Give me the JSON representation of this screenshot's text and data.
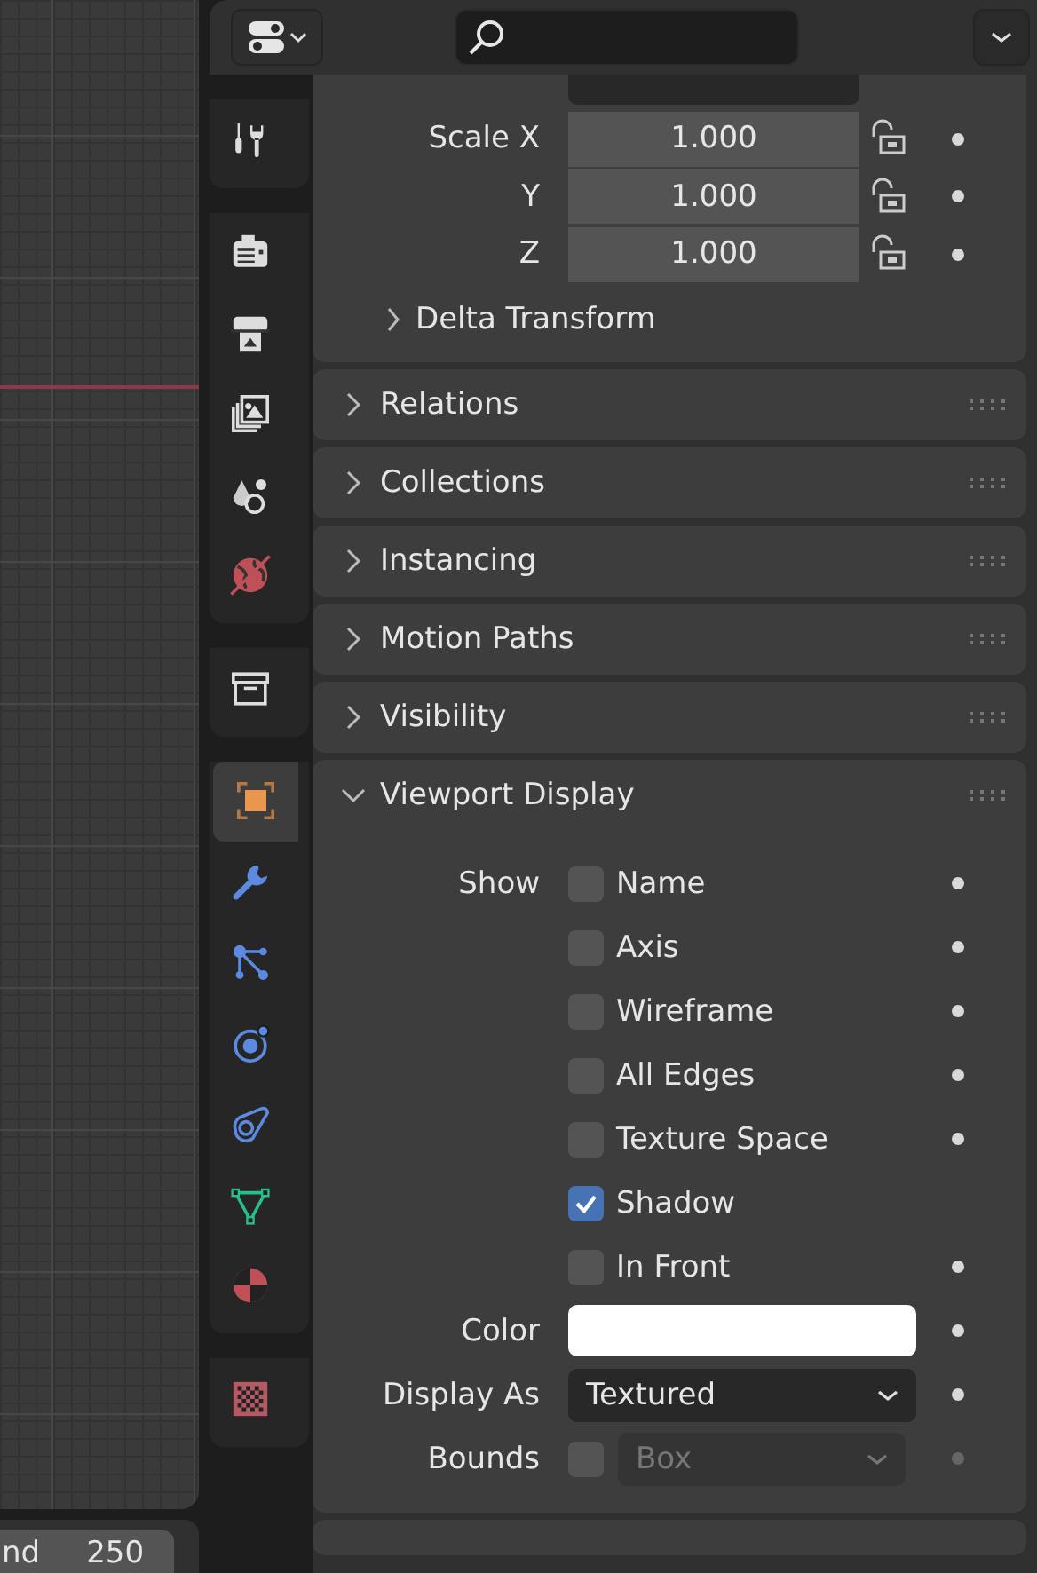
{
  "tabs": [
    {
      "selected": false
    },
    {
      "selected": false
    },
    {
      "selected": false
    },
    {
      "selected": false
    },
    {
      "selected": false
    },
    {
      "selected": false
    },
    {
      "selected": false
    },
    {
      "selected": true
    },
    {
      "selected": false
    },
    {
      "selected": false
    },
    {
      "selected": false
    },
    {
      "selected": false
    },
    {
      "selected": false
    },
    {
      "selected": false
    },
    {
      "selected": false
    }
  ],
  "transform": {
    "scale": [
      {
        "label": "Scale X",
        "value": "1.000",
        "locked": false
      },
      {
        "label": "Y",
        "value": "1.000",
        "locked": false
      },
      {
        "label": "Z",
        "value": "1.000",
        "locked": false
      }
    ],
    "subpanel": {
      "label": "Delta Transform",
      "expanded": false
    }
  },
  "panels": [
    {
      "label": "Relations",
      "expanded": false
    },
    {
      "label": "Collections",
      "expanded": false
    },
    {
      "label": "Instancing",
      "expanded": false
    },
    {
      "label": "Motion Paths",
      "expanded": false
    },
    {
      "label": "Visibility",
      "expanded": false
    },
    {
      "label": "Viewport Display",
      "expanded": true
    }
  ],
  "viewport_display": {
    "show_label": "Show",
    "show": [
      {
        "label": "Name",
        "checked": false,
        "animatable": true
      },
      {
        "label": "Axis",
        "checked": false,
        "animatable": true
      },
      {
        "label": "Wireframe",
        "checked": false,
        "animatable": true
      },
      {
        "label": "All Edges",
        "checked": false,
        "animatable": true
      },
      {
        "label": "Texture Space",
        "checked": false,
        "animatable": true
      },
      {
        "label": "Shadow",
        "checked": true,
        "animatable": false
      },
      {
        "label": "In Front",
        "checked": false,
        "animatable": true
      }
    ],
    "color": {
      "label": "Color",
      "color": "#ffffff"
    },
    "display_as": {
      "label": "Display As",
      "value": "Textured"
    },
    "bounds": {
      "label": "Bounds",
      "checked": false,
      "value": "Box",
      "disabled": true
    }
  },
  "timeline": {
    "label": "nd",
    "value": "250"
  }
}
